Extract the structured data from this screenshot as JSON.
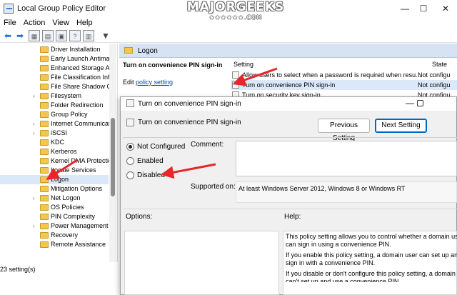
{
  "window": {
    "title": "Local Group Policy Editor",
    "minimize": "—",
    "maximize": "☐",
    "close": "✕"
  },
  "watermark": {
    "main": "MAJORGEEKS",
    "sub": "★★★★★★.COM"
  },
  "menu": [
    "File",
    "Action",
    "View",
    "Help"
  ],
  "toolbar_icons": [
    "back-icon",
    "forward-icon",
    "up-folder-icon",
    "show-hide-tree-icon",
    "properties-icon",
    "help-icon",
    "filter-icon"
  ],
  "tree": {
    "items": [
      {
        "label": "Driver Installation",
        "arrow": ""
      },
      {
        "label": "Early Launch Antimal",
        "arrow": ""
      },
      {
        "label": "Enhanced Storage Ac",
        "arrow": ""
      },
      {
        "label": "File Classification Infr",
        "arrow": ""
      },
      {
        "label": "File Share Shadow Co",
        "arrow": ""
      },
      {
        "label": "Filesystem",
        "arrow": "›"
      },
      {
        "label": "Folder Redirection",
        "arrow": ""
      },
      {
        "label": "Group Policy",
        "arrow": ""
      },
      {
        "label": "Internet Communicat",
        "arrow": "›"
      },
      {
        "label": "iSCSI",
        "arrow": "›"
      },
      {
        "label": "KDC",
        "arrow": ""
      },
      {
        "label": "Kerberos",
        "arrow": ""
      },
      {
        "label": "Kernel DMA Protectio",
        "arrow": ""
      },
      {
        "label": "Locale Services",
        "arrow": ""
      },
      {
        "label": "Logon",
        "arrow": "",
        "selected": true
      },
      {
        "label": "Mitigation Options",
        "arrow": ""
      },
      {
        "label": "Net Logon",
        "arrow": "›"
      },
      {
        "label": "OS Policies",
        "arrow": ""
      },
      {
        "label": "PIN Complexity",
        "arrow": ""
      },
      {
        "label": "Power Management",
        "arrow": "›"
      },
      {
        "label": "Recovery",
        "arrow": ""
      },
      {
        "label": "Remote Assistance",
        "arrow": ""
      }
    ]
  },
  "status": "23 setting(s)",
  "pane": {
    "header": "Logon",
    "description_title": "Turn on convenience PIN sign-in",
    "edit_prefix": "Edit ",
    "edit_link": "policy setting",
    "col_setting": "Setting",
    "col_state": "State",
    "settings": [
      {
        "name": "Allow users to select when a password is required when resu...",
        "state": "Not configu"
      },
      {
        "name": "Turn on convenience PIN sign-in",
        "state": "Not configu"
      },
      {
        "name": "Turn on security key sign-in",
        "state": "Not configu"
      }
    ]
  },
  "dialog": {
    "title": "Turn on convenience PIN sign-in",
    "header": "Turn on convenience PIN sign-in",
    "prev_button": "Previous Setting",
    "next_button": "Next Setting",
    "options": [
      {
        "label": "Not Configured",
        "selected": true
      },
      {
        "label": "Enabled",
        "selected": false
      },
      {
        "label": "Disabled",
        "selected": false
      }
    ],
    "comment_label": "Comment:",
    "supported_label": "Supported on:",
    "supported_value": "At least Windows Server 2012, Windows 8 or Windows RT",
    "options_label": "Options:",
    "help_label": "Help:",
    "help_lines": [
      "This policy setting allows you to control whether a domain user",
      "can sign in using a convenience PIN.",
      "If you enable this policy setting, a domain user can set up and",
      "sign in with a convenience PIN.",
      "If you disable or don't configure this policy setting, a domain us",
      "can't set up and use a convenience PIN."
    ]
  },
  "colors": {
    "selection": "#dbe8f7",
    "header": "#d6e3f3",
    "arrow": "#e8262a",
    "folder": "#f3c64e"
  }
}
